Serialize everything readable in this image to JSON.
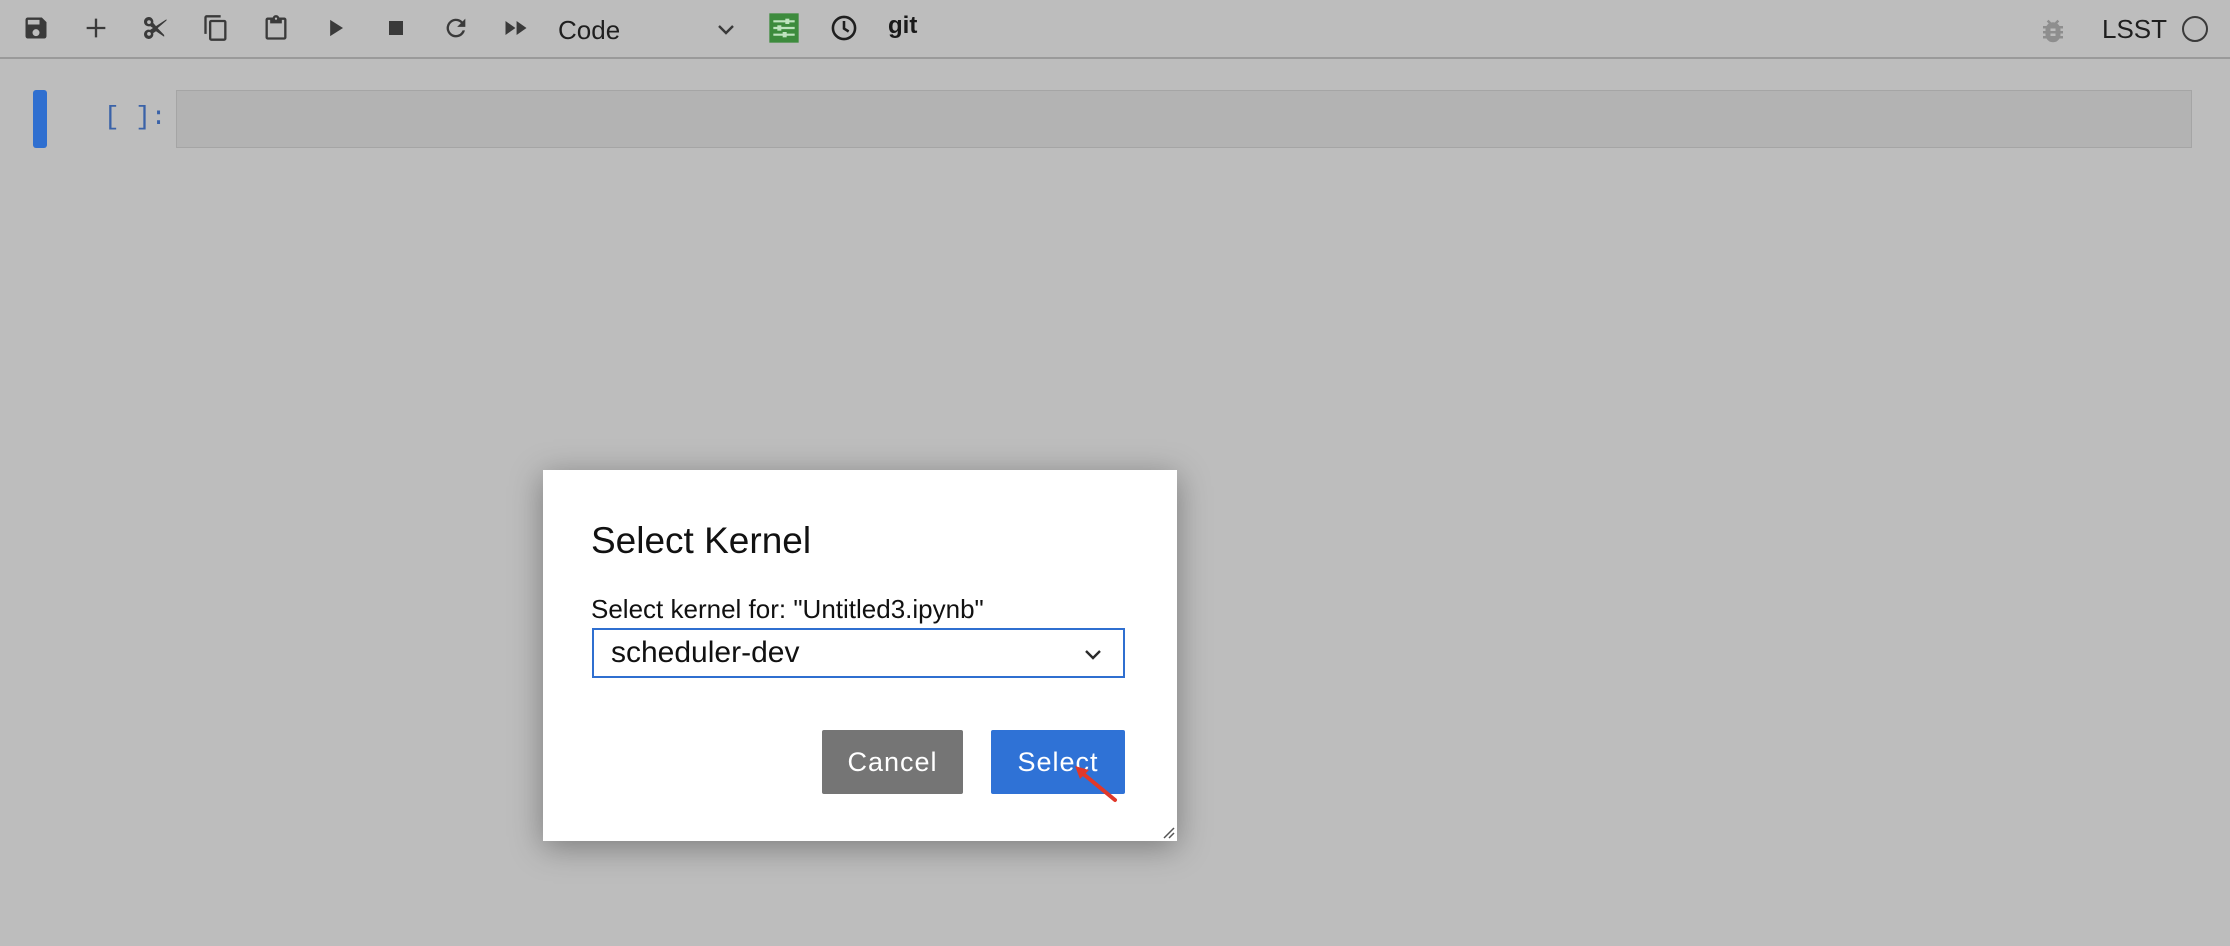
{
  "toolbar": {
    "cell_type": "Code",
    "git_label": "git",
    "kernel_name": "LSST",
    "icons": [
      "save-icon",
      "plus-icon",
      "scissors-icon",
      "copy-icon",
      "paste-icon",
      "run-icon",
      "stop-icon",
      "restart-icon",
      "fast-forward-icon",
      "chevron-down-icon",
      "property-inspector-icon",
      "clock-icon",
      "bug-icon",
      "kernel-status-icon"
    ]
  },
  "cell": {
    "prompt": "[ ]:",
    "content": ""
  },
  "dialog": {
    "title": "Select Kernel",
    "message": "Select kernel for: \"Untitled3.ipynb\"",
    "selected_kernel": "scheduler-dev",
    "cancel_label": "Cancel",
    "select_label": "Select"
  },
  "colors": {
    "accent": "#2f72d6",
    "cancel": "#757575",
    "backdrop": "#bdbdbd",
    "inspector": "#3d8b3d",
    "pointer": "#e0382a"
  }
}
